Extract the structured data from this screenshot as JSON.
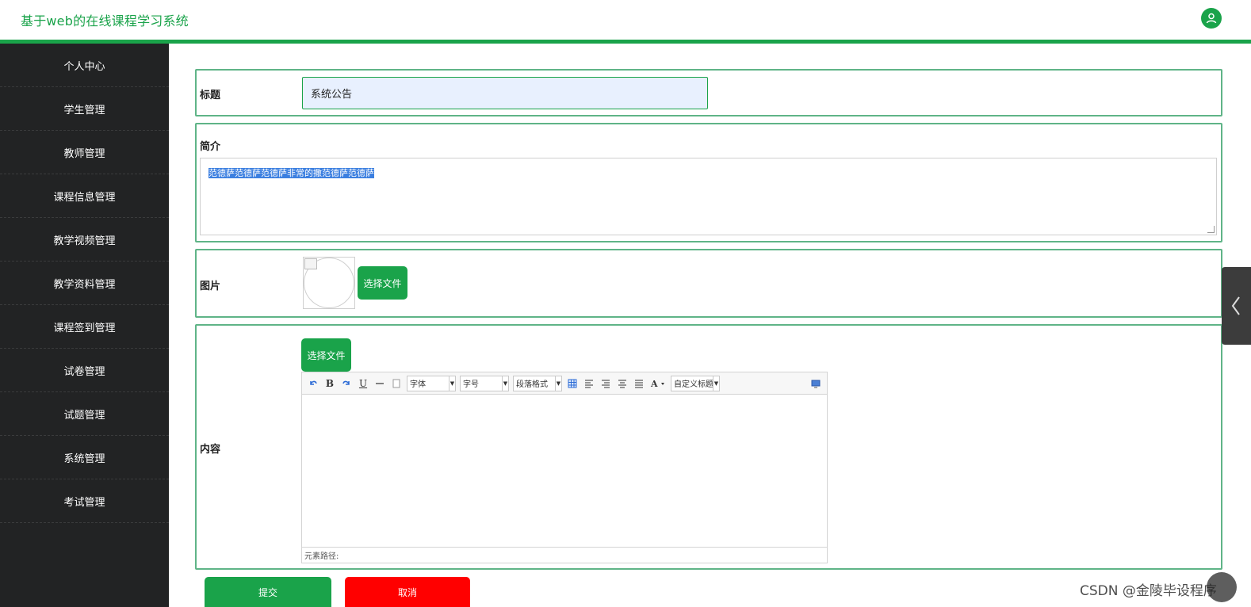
{
  "header": {
    "title": "基于web的在线课程学习系统",
    "avatar_icon": "user-icon",
    "accent_color": "#1aa34a"
  },
  "sidebar": {
    "items": [
      {
        "label": "个人中心"
      },
      {
        "label": "学生管理"
      },
      {
        "label": "教师管理"
      },
      {
        "label": "课程信息管理"
      },
      {
        "label": "教学视频管理"
      },
      {
        "label": "教学资料管理"
      },
      {
        "label": "课程签到管理"
      },
      {
        "label": "试卷管理"
      },
      {
        "label": "试题管理"
      },
      {
        "label": "系统管理"
      },
      {
        "label": "考试管理"
      }
    ]
  },
  "form": {
    "title_label": "标题",
    "title_value": "系统公告",
    "intro_label": "简介",
    "intro_value": "范德萨范德萨范德萨非常的撒范德萨范德萨",
    "image_label": "图片",
    "image_upload_button": "选择文件",
    "content_label": "内容",
    "content_upload_button": "选择文件",
    "editor": {
      "font_family": "字体",
      "font_size": "字号",
      "paragraph": "段落格式",
      "custom_title": "自定义标题",
      "status": "元素路径:"
    },
    "submit_button": "提交",
    "cancel_button": "取消",
    "submit_color": "#1aa34a",
    "cancel_color": "#ff0000"
  },
  "watermark": "CSDN @金陵毕设程序"
}
